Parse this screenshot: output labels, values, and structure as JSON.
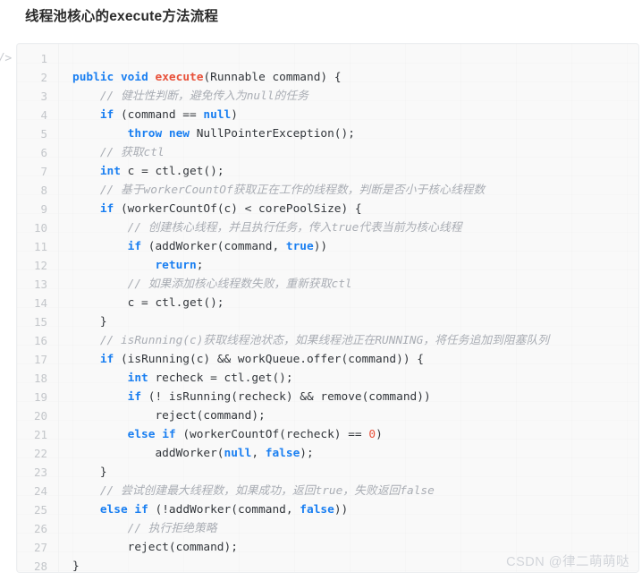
{
  "page": {
    "title": "线程池核心的execute方法流程",
    "watermark": "CSDN @律二萌萌哒",
    "code_marker": "/>",
    "language": "java",
    "colors": {
      "background": "#ffffff",
      "code_background": "#f9f9f9",
      "code_border": "#eceef0",
      "keyword": "#1a7ff1",
      "function": "#e8513a",
      "number": "#e8513a",
      "comment": "#a9adb4",
      "plain": "#32363b",
      "line_number": "#c3c6ca",
      "title": "#2b2b2b",
      "watermark": "#d2d5da"
    }
  },
  "code": {
    "first_line_number": 1,
    "total_lines": 28,
    "lines": [
      {
        "n": "1",
        "tokens": []
      },
      {
        "n": "2",
        "tokens": [
          {
            "t": "kw",
            "s": "public"
          },
          {
            "t": "pl",
            "s": " "
          },
          {
            "t": "kw",
            "s": "void"
          },
          {
            "t": "pl",
            "s": " "
          },
          {
            "t": "fn",
            "s": "execute"
          },
          {
            "t": "pl",
            "s": "(Runnable command) {"
          }
        ]
      },
      {
        "n": "3",
        "tokens": [
          {
            "t": "pl",
            "s": "    "
          },
          {
            "t": "cmt",
            "s": "// 健壮性判断，避免传入为null的任务"
          }
        ]
      },
      {
        "n": "4",
        "tokens": [
          {
            "t": "pl",
            "s": "    "
          },
          {
            "t": "kw",
            "s": "if"
          },
          {
            "t": "pl",
            "s": " (command == "
          },
          {
            "t": "kw",
            "s": "null"
          },
          {
            "t": "pl",
            "s": ")"
          }
        ]
      },
      {
        "n": "5",
        "tokens": [
          {
            "t": "pl",
            "s": "        "
          },
          {
            "t": "kw",
            "s": "throw"
          },
          {
            "t": "pl",
            "s": " "
          },
          {
            "t": "kw",
            "s": "new"
          },
          {
            "t": "pl",
            "s": " NullPointerException();"
          }
        ]
      },
      {
        "n": "6",
        "tokens": [
          {
            "t": "pl",
            "s": "    "
          },
          {
            "t": "cmt",
            "s": "// 获取ctl"
          }
        ]
      },
      {
        "n": "7",
        "tokens": [
          {
            "t": "pl",
            "s": "    "
          },
          {
            "t": "kw",
            "s": "int"
          },
          {
            "t": "pl",
            "s": " c = ctl.get();"
          }
        ]
      },
      {
        "n": "8",
        "tokens": [
          {
            "t": "pl",
            "s": "    "
          },
          {
            "t": "cmt",
            "s": "// 基于workerCountOf获取正在工作的线程数，判断是否小于核心线程数"
          }
        ]
      },
      {
        "n": "9",
        "tokens": [
          {
            "t": "pl",
            "s": "    "
          },
          {
            "t": "kw",
            "s": "if"
          },
          {
            "t": "pl",
            "s": " (workerCountOf(c) < corePoolSize) {"
          }
        ]
      },
      {
        "n": "10",
        "tokens": [
          {
            "t": "pl",
            "s": "        "
          },
          {
            "t": "cmt",
            "s": "// 创建核心线程，并且执行任务，传入true代表当前为核心线程"
          }
        ]
      },
      {
        "n": "11",
        "tokens": [
          {
            "t": "pl",
            "s": "        "
          },
          {
            "t": "kw",
            "s": "if"
          },
          {
            "t": "pl",
            "s": " (addWorker(command, "
          },
          {
            "t": "kw",
            "s": "true"
          },
          {
            "t": "pl",
            "s": "))"
          }
        ]
      },
      {
        "n": "12",
        "tokens": [
          {
            "t": "pl",
            "s": "            "
          },
          {
            "t": "kw",
            "s": "return"
          },
          {
            "t": "pl",
            "s": ";"
          }
        ]
      },
      {
        "n": "13",
        "tokens": [
          {
            "t": "pl",
            "s": "        "
          },
          {
            "t": "cmt",
            "s": "// 如果添加核心线程数失败，重新获取ctl"
          }
        ]
      },
      {
        "n": "14",
        "tokens": [
          {
            "t": "pl",
            "s": "        c = ctl.get();"
          }
        ]
      },
      {
        "n": "15",
        "tokens": [
          {
            "t": "pl",
            "s": "    }"
          }
        ]
      },
      {
        "n": "16",
        "tokens": [
          {
            "t": "pl",
            "s": "    "
          },
          {
            "t": "cmt",
            "s": "// isRunning(c)获取线程池状态，如果线程池正在RUNNING，将任务追加到阻塞队列"
          }
        ]
      },
      {
        "n": "17",
        "tokens": [
          {
            "t": "pl",
            "s": "    "
          },
          {
            "t": "kw",
            "s": "if"
          },
          {
            "t": "pl",
            "s": " (isRunning(c) && workQueue.offer(command)) {"
          }
        ]
      },
      {
        "n": "18",
        "tokens": [
          {
            "t": "pl",
            "s": "        "
          },
          {
            "t": "kw",
            "s": "int"
          },
          {
            "t": "pl",
            "s": " recheck = ctl.get();"
          }
        ]
      },
      {
        "n": "19",
        "tokens": [
          {
            "t": "pl",
            "s": "        "
          },
          {
            "t": "kw",
            "s": "if"
          },
          {
            "t": "pl",
            "s": " (! isRunning(recheck) && remove(command))"
          }
        ]
      },
      {
        "n": "20",
        "tokens": [
          {
            "t": "pl",
            "s": "            reject(command);"
          }
        ]
      },
      {
        "n": "21",
        "tokens": [
          {
            "t": "pl",
            "s": "        "
          },
          {
            "t": "kw",
            "s": "else"
          },
          {
            "t": "pl",
            "s": " "
          },
          {
            "t": "kw",
            "s": "if"
          },
          {
            "t": "pl",
            "s": " (workerCountOf(recheck) == "
          },
          {
            "t": "num",
            "s": "0"
          },
          {
            "t": "pl",
            "s": ")"
          }
        ]
      },
      {
        "n": "22",
        "tokens": [
          {
            "t": "pl",
            "s": "            addWorker("
          },
          {
            "t": "kw",
            "s": "null"
          },
          {
            "t": "pl",
            "s": ", "
          },
          {
            "t": "kw",
            "s": "false"
          },
          {
            "t": "pl",
            "s": ");"
          }
        ]
      },
      {
        "n": "23",
        "tokens": [
          {
            "t": "pl",
            "s": "    }"
          }
        ]
      },
      {
        "n": "24",
        "tokens": [
          {
            "t": "pl",
            "s": "    "
          },
          {
            "t": "cmt",
            "s": "// 尝试创建最大线程数，如果成功，返回true，失败返回false"
          }
        ]
      },
      {
        "n": "25",
        "tokens": [
          {
            "t": "pl",
            "s": "    "
          },
          {
            "t": "kw",
            "s": "else"
          },
          {
            "t": "pl",
            "s": " "
          },
          {
            "t": "kw",
            "s": "if"
          },
          {
            "t": "pl",
            "s": " (!addWorker(command, "
          },
          {
            "t": "kw",
            "s": "false"
          },
          {
            "t": "pl",
            "s": "))"
          }
        ]
      },
      {
        "n": "26",
        "tokens": [
          {
            "t": "pl",
            "s": "        "
          },
          {
            "t": "cmt",
            "s": "// 执行拒绝策略"
          }
        ]
      },
      {
        "n": "27",
        "tokens": [
          {
            "t": "pl",
            "s": "        reject(command);"
          }
        ]
      },
      {
        "n": "28",
        "tokens": [
          {
            "t": "pl",
            "s": "}"
          }
        ]
      }
    ]
  }
}
